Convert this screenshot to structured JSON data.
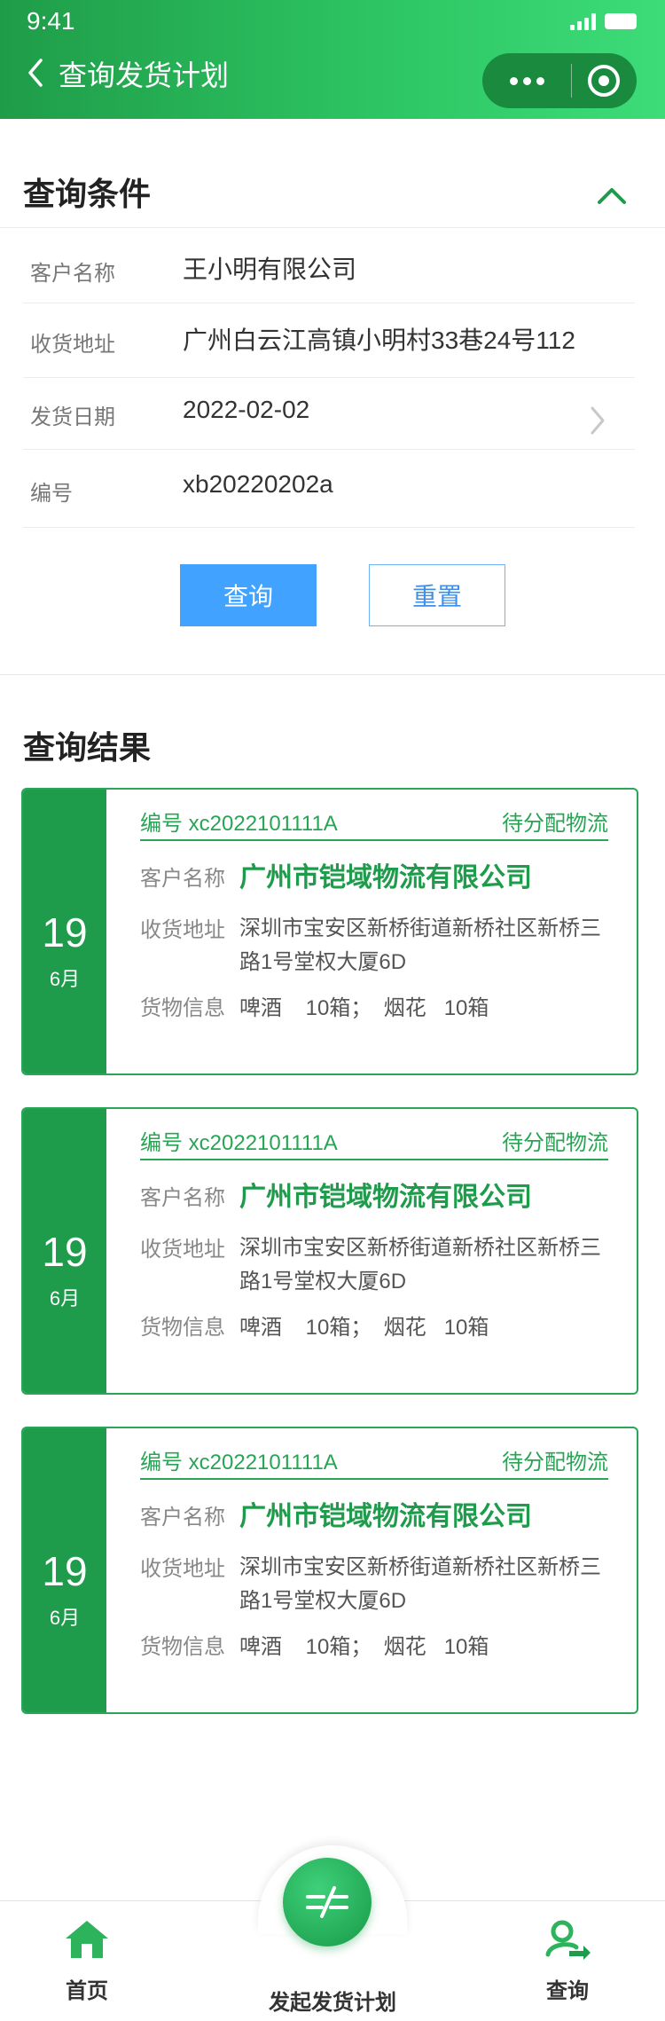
{
  "status_bar": {
    "time": "9:41"
  },
  "nav": {
    "title": "查询发货计划"
  },
  "query": {
    "title": "查询条件",
    "fields": [
      {
        "label": "客户名称",
        "value": "王小明有限公司"
      },
      {
        "label": "收货地址",
        "value": "广州白云江高镇小明村33巷24号112"
      },
      {
        "label": "发货日期",
        "value": "2022-02-02"
      },
      {
        "label": "编号",
        "value": "xb20220202a"
      }
    ],
    "search_label": "查询",
    "reset_label": "重置"
  },
  "results": {
    "title": "查询结果",
    "items": [
      {
        "day": "19",
        "month": "6月",
        "number": "编号 xc2022101111A",
        "status": "待分配物流",
        "customer_label": "客户名称",
        "customer": "广州市铠域物流有限公司",
        "address_label": "收货地址",
        "address": "深圳市宝安区新桥街道新桥社区新桥三路1号堂权大厦6D",
        "goods_label": "货物信息",
        "goods": "啤酒    10箱；  烟花   10箱"
      },
      {
        "day": "19",
        "month": "6月",
        "number": "编号 xc2022101111A",
        "status": "待分配物流",
        "customer_label": "客户名称",
        "customer": "广州市铠域物流有限公司",
        "address_label": "收货地址",
        "address": "深圳市宝安区新桥街道新桥社区新桥三路1号堂权大厦6D",
        "goods_label": "货物信息",
        "goods": "啤酒    10箱；  烟花   10箱"
      },
      {
        "day": "19",
        "month": "6月",
        "number": "编号 xc2022101111A",
        "status": "待分配物流",
        "customer_label": "客户名称",
        "customer": "广州市铠域物流有限公司",
        "address_label": "收货地址",
        "address": "深圳市宝安区新桥街道新桥社区新桥三路1号堂权大厦6D",
        "goods_label": "货物信息",
        "goods": "啤酒    10箱；  烟花   10箱"
      }
    ]
  },
  "tabbar": {
    "home_label": "首页",
    "create_label": "发起发货计划",
    "query_label": "查询"
  },
  "colors": {
    "brand_green": "#1f9b4c",
    "button_blue": "#41a3ff"
  },
  "icons": {
    "home": "home-icon",
    "create": "create-plan-icon",
    "query": "query-user-icon"
  }
}
